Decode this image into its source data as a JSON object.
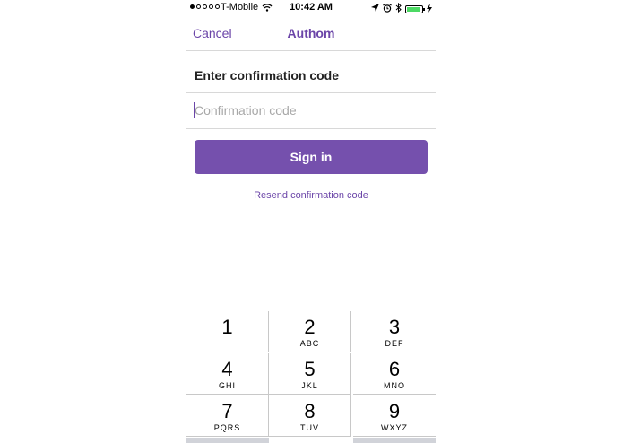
{
  "status_bar": {
    "carrier": "T-Mobile",
    "time": "10:42 AM",
    "signal_bars_filled": 1,
    "signal_bars_total": 5,
    "battery_level": 0.8,
    "icons": [
      "location-icon",
      "alarm-icon",
      "bluetooth-icon",
      "battery-icon",
      "charging-icon"
    ]
  },
  "nav": {
    "cancel_label": "Cancel",
    "title": "Authom"
  },
  "form": {
    "heading": "Enter confirmation code",
    "code_placeholder": "Confirmation code",
    "code_value": "",
    "sign_in_label": "Sign in",
    "resend_label": "Resend confirmation code"
  },
  "keypad": {
    "keys": [
      {
        "num": "1",
        "letters": ""
      },
      {
        "num": "2",
        "letters": "ABC"
      },
      {
        "num": "3",
        "letters": "DEF"
      },
      {
        "num": "4",
        "letters": "GHI"
      },
      {
        "num": "5",
        "letters": "JKL"
      },
      {
        "num": "6",
        "letters": "MNO"
      },
      {
        "num": "7",
        "letters": "PQRS"
      },
      {
        "num": "8",
        "letters": "TUV"
      },
      {
        "num": "9",
        "letters": "WXYZ"
      }
    ]
  },
  "colors": {
    "accent": "#6b45a8",
    "button": "#7550ad",
    "battery_fill": "#4cd964"
  }
}
